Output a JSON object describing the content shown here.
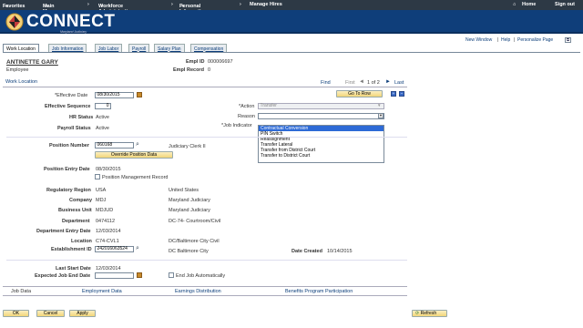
{
  "topnav": {
    "favorites": "Favorites",
    "main_menu": "Main Menu",
    "workforce": "Workforce Administration",
    "personal": "Personal Information",
    "manage_hires": "Manage Hires",
    "home": "Home",
    "signout": "Sign out"
  },
  "brand": {
    "name": "CONNECT",
    "sub": "Maryland Judiciary"
  },
  "toplinks": {
    "new_window": "New Window",
    "help": "Help",
    "personalize": "Personalize Page",
    "sep": "|"
  },
  "tabs": [
    "Work Location",
    "Job Information",
    "Job Labor",
    "Payroll",
    "Salary Plan",
    "Compensation"
  ],
  "employee": {
    "name": "ANTINETTE GARY",
    "type": "Employee",
    "empl_id_label": "Empl ID",
    "empl_id": "000006697",
    "empl_record_label": "Empl Record",
    "empl_record": "0"
  },
  "section": {
    "title": "Work Location",
    "find": "Find",
    "first": "First",
    "count": "1 of 2",
    "last": "Last",
    "go_to_row": "Go To Row"
  },
  "form": {
    "effective_date_label": "*Effective Date",
    "effective_date": "08/30/2015",
    "effective_seq_label": "Effective Sequence",
    "effective_seq": "0",
    "action_label": "*Action",
    "action": "Transfer",
    "reason_label": "Reason",
    "hr_status_label": "HR Status",
    "hr_status": "Active",
    "payroll_status_label": "Payroll Status",
    "payroll_status": "Active",
    "job_indicator_label": "*Job Indicator",
    "position_number_label": "Position Number",
    "position_number": "060168",
    "position_title": "Judiciary Clerk II",
    "override_button": "Override Position Data",
    "position_entry_label": "Position Entry Date",
    "position_entry": "08/30/2015",
    "pos_mgmt_label": "Position Management Record",
    "reg_region_label": "Regulatory Region",
    "reg_region": "USA",
    "reg_region_desc": "United States",
    "company_label": "Company",
    "company": "MDJ",
    "company_desc": "Maryland Judiciary",
    "bu_label": "Business Unit",
    "bu": "MDJUD",
    "bu_desc": "Maryland Judiciary",
    "dept_label": "Department",
    "dept": "0474112",
    "dept_desc": "DC-74- Courtroom/Civil",
    "dept_entry_label": "Department Entry Date",
    "dept_entry": "12/03/2014",
    "location_label": "Location",
    "location": "C74-CVL1",
    "location_desc": "DC/Baltimore City Civil",
    "estab_label": "Establishment ID",
    "estab": "242016063524",
    "estab_desc": "DC Baltimore City",
    "date_created_label": "Date Created",
    "date_created": "10/14/2015",
    "last_start_label": "Last Start Date",
    "last_start": "12/03/2014",
    "exp_end_label": "Expected Job End Date",
    "end_job_label": "End Job Automatically"
  },
  "reason_options": [
    "Contractual Conversion",
    "PIN Switch",
    "Reassignment",
    "Transfer Lateral",
    "Transfer from District Court",
    "Transfer to District Court"
  ],
  "bottom_links": [
    "Job Data",
    "Employment Data",
    "Earnings Distribution",
    "Benefits Program Participation"
  ],
  "footer": {
    "ok": "OK",
    "cancel": "Cancel",
    "apply": "Apply",
    "refresh": "Refresh"
  },
  "colors": {
    "header_bg": "#0f3e7a",
    "topbar_bg": "#2d3945",
    "link": "#0b3d7a",
    "selected_option": "#2d6ad6"
  }
}
